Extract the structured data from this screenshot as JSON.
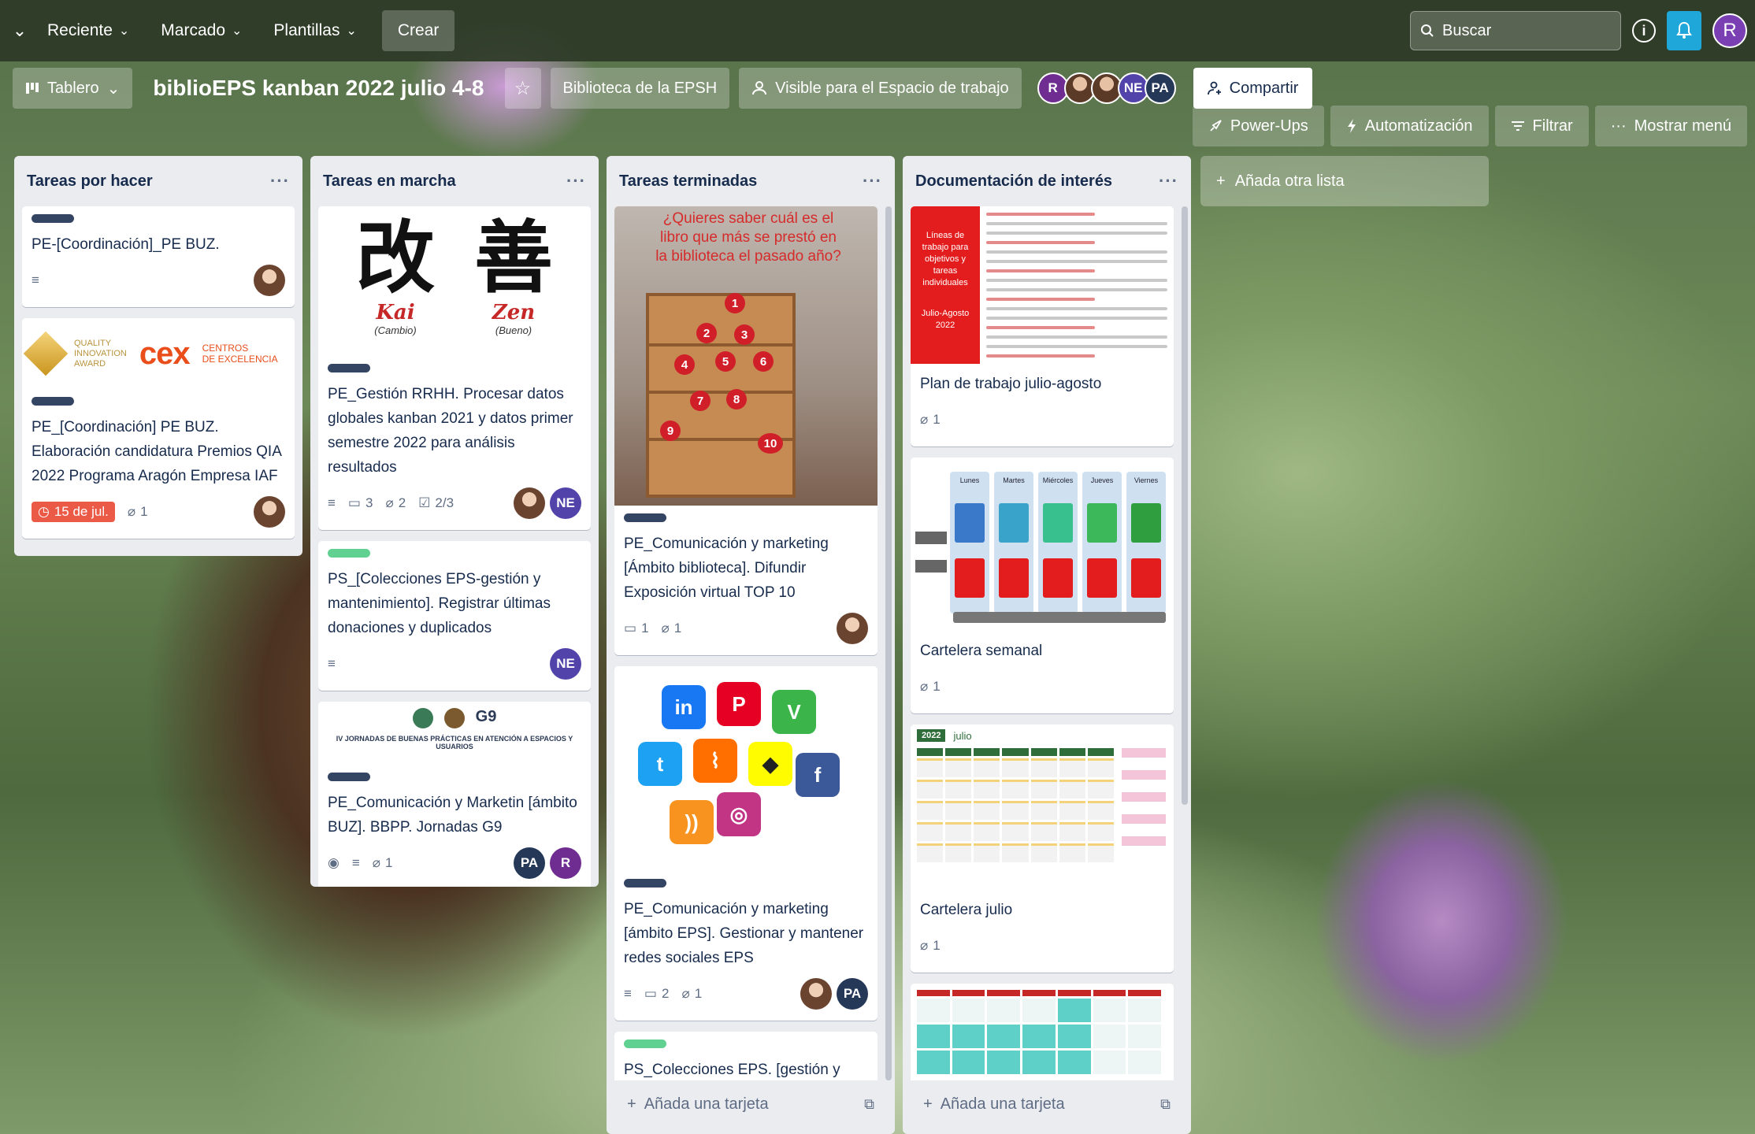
{
  "topbar": {
    "menus": [
      "Reciente",
      "Marcado",
      "Plantillas"
    ],
    "create_label": "Crear",
    "search_placeholder": "Buscar",
    "me_initial": "R"
  },
  "board": {
    "view_label": "Tablero",
    "title": "biblioEPS kanban 2022 julio 4-8",
    "workspace_label": "Biblioteca de la EPSH",
    "visibility_label": "Visible para el Espacio de trabajo",
    "members": [
      {
        "initials": "R",
        "color": "#6f2c91"
      },
      {
        "initials": "",
        "color": "#5b3a28"
      },
      {
        "initials": "",
        "color": "#5b3a28"
      },
      {
        "initials": "NE",
        "color": "#5243aa"
      },
      {
        "initials": "PA",
        "color": "#253858"
      }
    ],
    "share_label": "Compartir",
    "actions": {
      "powerups": "Power-Ups",
      "automation": "Automatización",
      "filter": "Filtrar",
      "menu": "Mostrar menú"
    },
    "add_list_label": "Añada otra lista",
    "add_card_label": "Añada una tarjeta"
  },
  "lists": [
    {
      "title": "Tareas por hacer",
      "cards": [
        {
          "title": "PE-[Coordinación]_PE BUZ."
        },
        {
          "title": "PE_[Coordinación] PE BUZ. Elaboración candidatura Premios QIA 2022 Programa Aragón Empresa IAF",
          "due": "15 de jul.",
          "attachments": "1",
          "cover": {
            "qia_line1": "QUALITY",
            "qia_line2": "INNOVATION",
            "qia_line3": "AWARD",
            "cex": "cex",
            "cex_line1": "CENTROS",
            "cex_line2": "DE EXCELENCIA"
          }
        }
      ]
    },
    {
      "title": "Tareas en marcha",
      "cards": [
        {
          "title": "PE_Gestión RRHH. Procesar datos globales kanban 2021 y datos primer semestre 2022 para análisis resultados",
          "comments": "3",
          "attachments": "2",
          "checklist": "2/3",
          "cover": {
            "kanji1": "改",
            "kanji2": "善",
            "romaji1": "Kai",
            "romaji2": "Zen",
            "meaning1": "(Cambio)",
            "meaning2": "(Bueno)"
          }
        },
        {
          "title": "PS_[Colecciones EPS-gestión y mantenimiento]. Registrar últimas donaciones y duplicados"
        },
        {
          "title": "PE_Comunicación y Marketin [ámbito BUZ]. BBPP. Jornadas G9",
          "attachments": "1",
          "cover": {
            "g9": "G9",
            "text": "IV JORNADAS DE BUENAS PRÁCTICAS EN ATENCIÓN A ESPACIOS Y USUARIOS"
          }
        }
      ]
    },
    {
      "title": "Tareas terminadas",
      "cards": [
        {
          "title": "PE_Comunicación y marketing [Ámbito biblioteca]. Difundir Exposición virtual TOP 10",
          "comments": "1",
          "attachments": "1",
          "cover": {
            "text": "¿Quieres saber cuál es el libro que más se prestó en la biblioteca el pasado año?"
          }
        },
        {
          "title": "PE_Comunicación y marketing [ámbito EPS]. Gestionar y mantener redes sociales EPS",
          "comments": "2",
          "attachments": "1"
        },
        {
          "title": "PS_Colecciones EPS. [gestión y mantenimiento]. Gestionar y"
        }
      ]
    },
    {
      "title": "Documentación de interés",
      "cards": [
        {
          "title": "Plan de trabajo julio-agosto",
          "attachments": "1",
          "cover": {
            "text": "Líneas de trabajo para objetivos y tareas individuales",
            "period": "Julio-Agosto 2022"
          }
        },
        {
          "title": "Cartelera semanal",
          "attachments": "1",
          "cover": {
            "days": [
              "Lunes",
              "Martes",
              "Miércoles",
              "Jueves",
              "Viernes"
            ]
          }
        },
        {
          "title": "Cartelera julio",
          "attachments": "1",
          "cover": {
            "year": "2022",
            "month": "julio"
          }
        },
        {
          "title": ""
        }
      ]
    }
  ],
  "colors": {
    "label_dark": "#344563",
    "label_green": "#61d191",
    "due_red": "#eb5a46",
    "bell_blue": "#1ea7d8"
  },
  "icons": [
    "chevron-down-icon",
    "search-icon",
    "info-icon",
    "bell-icon",
    "board-icon",
    "star-icon",
    "people-icon",
    "share-icon",
    "rocket-icon",
    "bolt-icon",
    "filter-icon",
    "ellipsis-icon",
    "plus-icon",
    "template-icon",
    "description-icon",
    "comment-icon",
    "attachment-icon",
    "checklist-icon",
    "watch-icon",
    "clock-icon"
  ]
}
